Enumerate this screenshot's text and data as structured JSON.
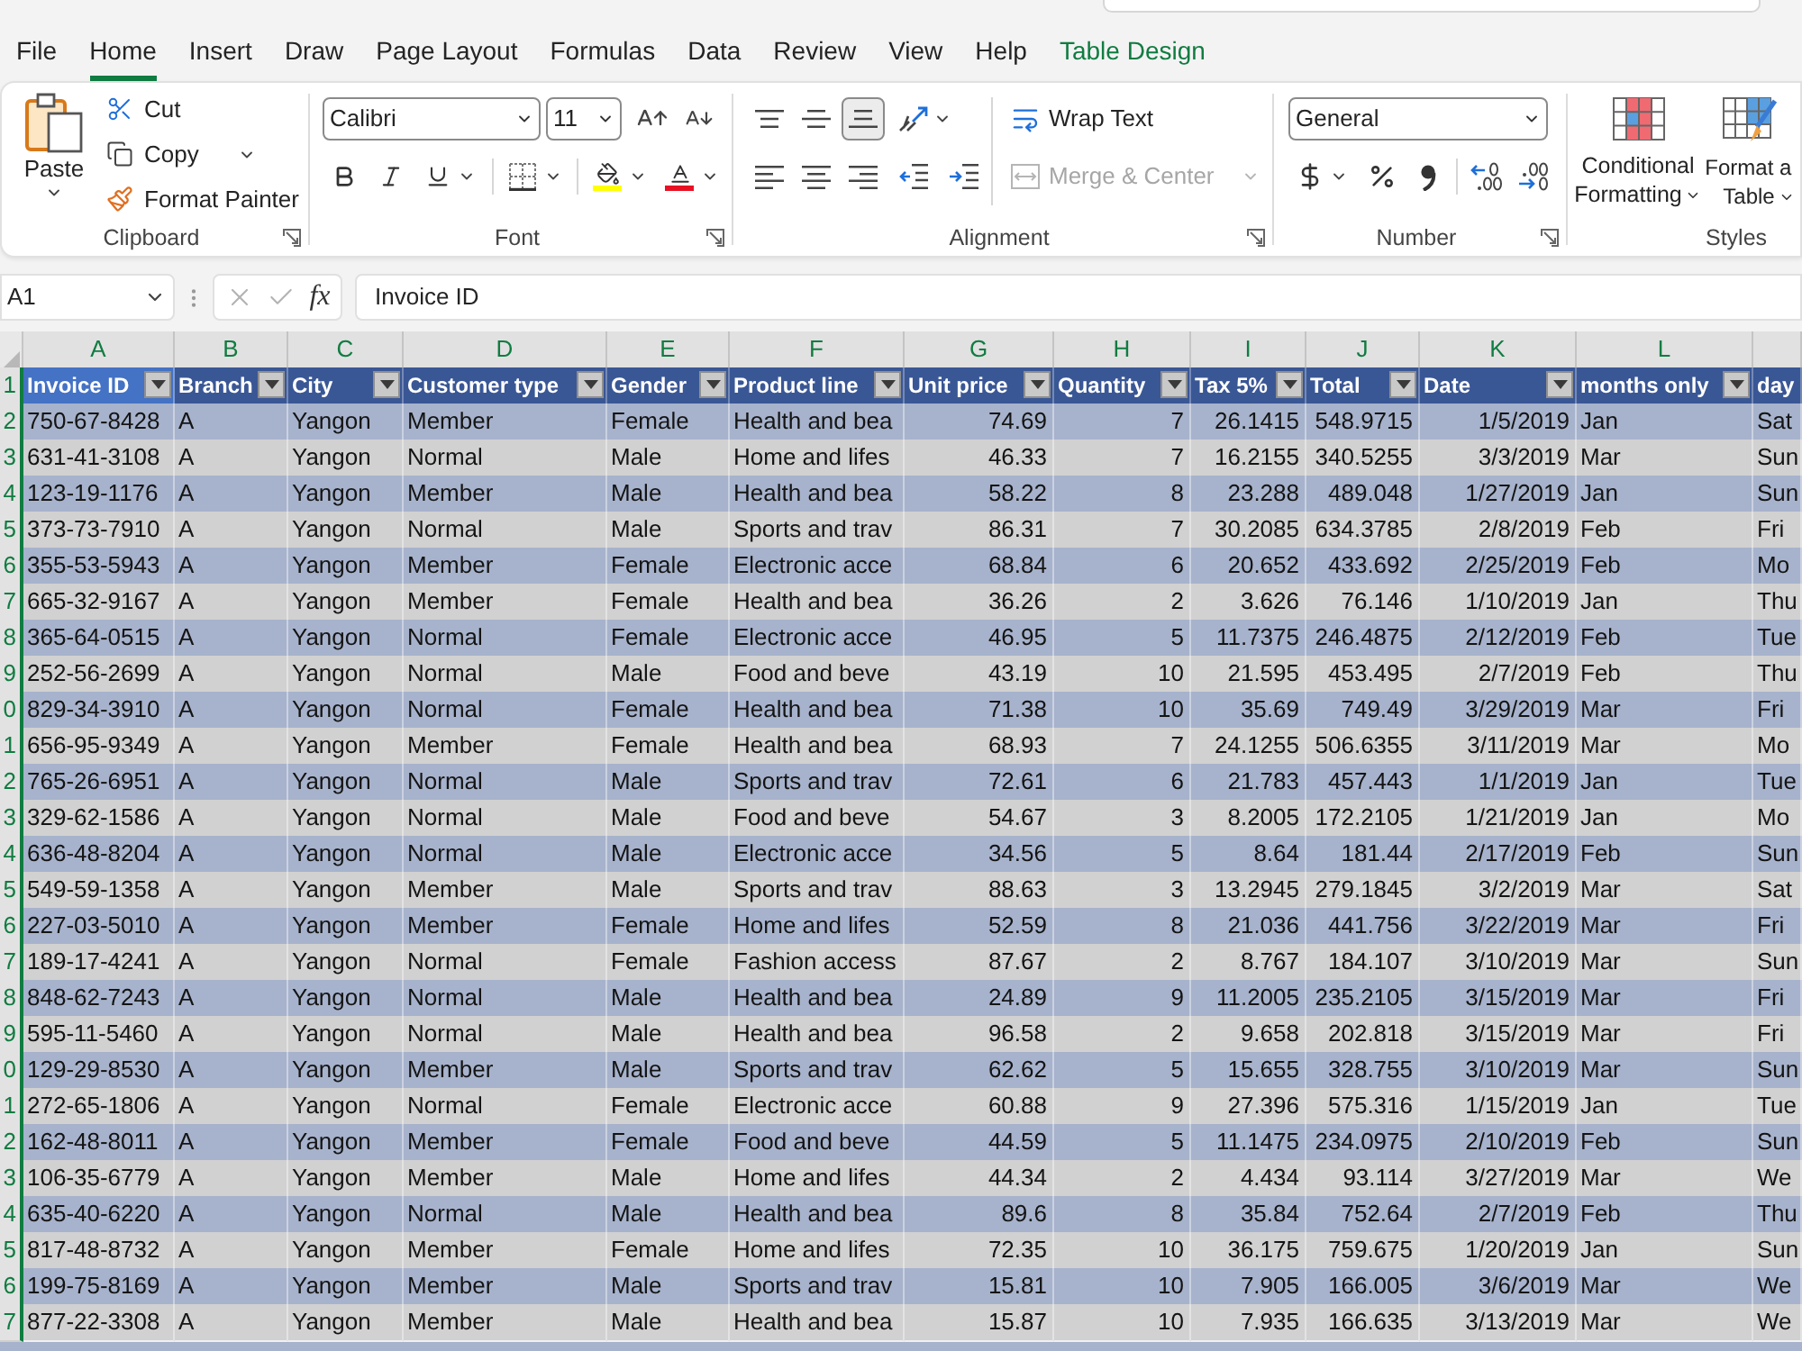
{
  "ribbon_tabs": [
    {
      "label": "File",
      "selected": false,
      "kind": "standard"
    },
    {
      "label": "Home",
      "selected": true,
      "kind": "standard"
    },
    {
      "label": "Insert",
      "selected": false,
      "kind": "standard"
    },
    {
      "label": "Draw",
      "selected": false,
      "kind": "standard"
    },
    {
      "label": "Page Layout",
      "selected": false,
      "kind": "standard"
    },
    {
      "label": "Formulas",
      "selected": false,
      "kind": "standard"
    },
    {
      "label": "Data",
      "selected": false,
      "kind": "standard"
    },
    {
      "label": "Review",
      "selected": false,
      "kind": "standard"
    },
    {
      "label": "View",
      "selected": false,
      "kind": "standard"
    },
    {
      "label": "Help",
      "selected": false,
      "kind": "standard"
    },
    {
      "label": "Table Design",
      "selected": false,
      "kind": "contextual"
    }
  ],
  "ribbon": {
    "groups": [
      {
        "kind": "clipboard",
        "label": "Clipboard",
        "paste": "Paste",
        "cut": "Cut",
        "copy": "Copy",
        "format_painter": "Format Painter"
      },
      {
        "kind": "font",
        "label": "Font",
        "font_name": "Calibri",
        "font_size": "11"
      },
      {
        "kind": "alignment",
        "label": "Alignment",
        "vertical": [
          {
            "kind": "top",
            "selected": false
          },
          {
            "kind": "middle",
            "selected": false
          },
          {
            "kind": "bottom",
            "selected": true
          }
        ],
        "horizontal": [
          {
            "kind": "left",
            "selected": false
          },
          {
            "kind": "center",
            "selected": false
          },
          {
            "kind": "right",
            "selected": false
          }
        ],
        "wrap_text": "Wrap Text",
        "merge": {
          "label": "Merge & Center",
          "disabled": true
        }
      },
      {
        "kind": "number",
        "label": "Number",
        "format": "General"
      },
      {
        "kind": "styles",
        "label": "Styles",
        "buttons": [
          {
            "kind": "conditional_formatting",
            "lines": [
              "Conditional",
              "Formatting"
            ]
          },
          {
            "kind": "format_as_table",
            "lines": [
              "Format a",
              "Table"
            ]
          }
        ]
      }
    ]
  },
  "formula_bar": {
    "name_box": "A1",
    "function_button": "fx",
    "formula": "Invoice ID"
  },
  "sheet": {
    "columns": [
      {
        "letter": "A",
        "selected": true,
        "kind": "text"
      },
      {
        "letter": "B",
        "selected": true,
        "kind": "text"
      },
      {
        "letter": "C",
        "selected": true,
        "kind": "text"
      },
      {
        "letter": "D",
        "selected": true,
        "kind": "text"
      },
      {
        "letter": "E",
        "selected": true,
        "kind": "text"
      },
      {
        "letter": "F",
        "selected": true,
        "kind": "text"
      },
      {
        "letter": "G",
        "selected": true,
        "kind": "number"
      },
      {
        "letter": "H",
        "selected": true,
        "kind": "number"
      },
      {
        "letter": "I",
        "selected": true,
        "kind": "number"
      },
      {
        "letter": "J",
        "selected": true,
        "kind": "number"
      },
      {
        "letter": "K",
        "selected": true,
        "kind": "number"
      },
      {
        "letter": "L",
        "selected": true,
        "kind": "text"
      },
      {
        "selected": true,
        "kind": "text"
      }
    ],
    "header_row": {
      "number": "1",
      "selected": true,
      "cells": [
        {
          "text": "Invoice ID",
          "active": true,
          "filter_button": true
        },
        {
          "text": "Branch",
          "active": false,
          "filter_button": true
        },
        {
          "text": "City",
          "active": false,
          "filter_button": true
        },
        {
          "text": "Customer type",
          "active": false,
          "filter_button": true
        },
        {
          "text": "Gender",
          "active": false,
          "filter_button": true
        },
        {
          "text": "Product line",
          "active": false,
          "filter_button": true
        },
        {
          "text": "Unit price",
          "active": false,
          "filter_button": true
        },
        {
          "text": "Quantity",
          "active": false,
          "filter_button": true
        },
        {
          "text": "Tax 5%",
          "active": false,
          "filter_button": true
        },
        {
          "text": "Total",
          "active": false,
          "filter_button": true
        },
        {
          "text": "Date",
          "active": false,
          "filter_button": true
        },
        {
          "text": "months only",
          "active": false,
          "filter_button": true
        },
        {
          "text": "day",
          "active": false,
          "filter_button": false
        }
      ]
    },
    "rows": [
      {
        "number": "2",
        "selected": true,
        "cells": [
          "750-67-8428",
          "A",
          "Yangon",
          "Member",
          "Female",
          "Health and bea",
          "74.69",
          "7",
          "26.1415",
          "548.9715",
          "1/5/2019",
          "Jan",
          "Sat"
        ]
      },
      {
        "number": "3",
        "selected": true,
        "cells": [
          "631-41-3108",
          "A",
          "Yangon",
          "Normal",
          "Male",
          "Home and lifes",
          "46.33",
          "7",
          "16.2155",
          "340.5255",
          "3/3/2019",
          "Mar",
          "Sun"
        ]
      },
      {
        "number": "4",
        "selected": true,
        "cells": [
          "123-19-1176",
          "A",
          "Yangon",
          "Member",
          "Male",
          "Health and bea",
          "58.22",
          "8",
          "23.288",
          "489.048",
          "1/27/2019",
          "Jan",
          "Sun"
        ]
      },
      {
        "number": "5",
        "selected": true,
        "cells": [
          "373-73-7910",
          "A",
          "Yangon",
          "Normal",
          "Male",
          "Sports and trav",
          "86.31",
          "7",
          "30.2085",
          "634.3785",
          "2/8/2019",
          "Feb",
          "Fri"
        ]
      },
      {
        "number": "6",
        "selected": true,
        "cells": [
          "355-53-5943",
          "A",
          "Yangon",
          "Member",
          "Female",
          "Electronic acce",
          "68.84",
          "6",
          "20.652",
          "433.692",
          "2/25/2019",
          "Feb",
          "Mo"
        ]
      },
      {
        "number": "7",
        "selected": true,
        "cells": [
          "665-32-9167",
          "A",
          "Yangon",
          "Member",
          "Female",
          "Health and bea",
          "36.26",
          "2",
          "3.626",
          "76.146",
          "1/10/2019",
          "Jan",
          "Thu"
        ]
      },
      {
        "number": "8",
        "selected": true,
        "cells": [
          "365-64-0515",
          "A",
          "Yangon",
          "Normal",
          "Female",
          "Electronic acce",
          "46.95",
          "5",
          "11.7375",
          "246.4875",
          "2/12/2019",
          "Feb",
          "Tue"
        ]
      },
      {
        "number": "9",
        "selected": true,
        "cells": [
          "252-56-2699",
          "A",
          "Yangon",
          "Normal",
          "Male",
          "Food and beve",
          "43.19",
          "10",
          "21.595",
          "453.495",
          "2/7/2019",
          "Feb",
          "Thu"
        ]
      },
      {
        "number": "0",
        "selected": true,
        "cells": [
          "829-34-3910",
          "A",
          "Yangon",
          "Normal",
          "Female",
          "Health and bea",
          "71.38",
          "10",
          "35.69",
          "749.49",
          "3/29/2019",
          "Mar",
          "Fri"
        ]
      },
      {
        "number": "1",
        "selected": true,
        "cells": [
          "656-95-9349",
          "A",
          "Yangon",
          "Member",
          "Female",
          "Health and bea",
          "68.93",
          "7",
          "24.1255",
          "506.6355",
          "3/11/2019",
          "Mar",
          "Mo"
        ]
      },
      {
        "number": "2",
        "selected": true,
        "cells": [
          "765-26-6951",
          "A",
          "Yangon",
          "Normal",
          "Male",
          "Sports and trav",
          "72.61",
          "6",
          "21.783",
          "457.443",
          "1/1/2019",
          "Jan",
          "Tue"
        ]
      },
      {
        "number": "3",
        "selected": true,
        "cells": [
          "329-62-1586",
          "A",
          "Yangon",
          "Normal",
          "Male",
          "Food and beve",
          "54.67",
          "3",
          "8.2005",
          "172.2105",
          "1/21/2019",
          "Jan",
          "Mo"
        ]
      },
      {
        "number": "4",
        "selected": true,
        "cells": [
          "636-48-8204",
          "A",
          "Yangon",
          "Normal",
          "Male",
          "Electronic acce",
          "34.56",
          "5",
          "8.64",
          "181.44",
          "2/17/2019",
          "Feb",
          "Sun"
        ]
      },
      {
        "number": "5",
        "selected": true,
        "cells": [
          "549-59-1358",
          "A",
          "Yangon",
          "Member",
          "Male",
          "Sports and trav",
          "88.63",
          "3",
          "13.2945",
          "279.1845",
          "3/2/2019",
          "Mar",
          "Sat"
        ]
      },
      {
        "number": "6",
        "selected": true,
        "cells": [
          "227-03-5010",
          "A",
          "Yangon",
          "Member",
          "Female",
          "Home and lifes",
          "52.59",
          "8",
          "21.036",
          "441.756",
          "3/22/2019",
          "Mar",
          "Fri"
        ]
      },
      {
        "number": "7",
        "selected": true,
        "cells": [
          "189-17-4241",
          "A",
          "Yangon",
          "Normal",
          "Female",
          "Fashion access",
          "87.67",
          "2",
          "8.767",
          "184.107",
          "3/10/2019",
          "Mar",
          "Sun"
        ]
      },
      {
        "number": "8",
        "selected": true,
        "cells": [
          "848-62-7243",
          "A",
          "Yangon",
          "Normal",
          "Male",
          "Health and bea",
          "24.89",
          "9",
          "11.2005",
          "235.2105",
          "3/15/2019",
          "Mar",
          "Fri"
        ]
      },
      {
        "number": "9",
        "selected": true,
        "cells": [
          "595-11-5460",
          "A",
          "Yangon",
          "Normal",
          "Male",
          "Health and bea",
          "96.58",
          "2",
          "9.658",
          "202.818",
          "3/15/2019",
          "Mar",
          "Fri"
        ]
      },
      {
        "number": "0",
        "selected": true,
        "cells": [
          "129-29-8530",
          "A",
          "Yangon",
          "Member",
          "Male",
          "Sports and trav",
          "62.62",
          "5",
          "15.655",
          "328.755",
          "3/10/2019",
          "Mar",
          "Sun"
        ]
      },
      {
        "number": "1",
        "selected": true,
        "cells": [
          "272-65-1806",
          "A",
          "Yangon",
          "Normal",
          "Female",
          "Electronic acce",
          "60.88",
          "9",
          "27.396",
          "575.316",
          "1/15/2019",
          "Jan",
          "Tue"
        ]
      },
      {
        "number": "2",
        "selected": true,
        "cells": [
          "162-48-8011",
          "A",
          "Yangon",
          "Member",
          "Female",
          "Food and beve",
          "44.59",
          "5",
          "11.1475",
          "234.0975",
          "2/10/2019",
          "Feb",
          "Sun"
        ]
      },
      {
        "number": "3",
        "selected": true,
        "cells": [
          "106-35-6779",
          "A",
          "Yangon",
          "Member",
          "Male",
          "Home and lifes",
          "44.34",
          "2",
          "4.434",
          "93.114",
          "3/27/2019",
          "Mar",
          "We"
        ]
      },
      {
        "number": "4",
        "selected": true,
        "cells": [
          "635-40-6220",
          "A",
          "Yangon",
          "Normal",
          "Male",
          "Health and bea",
          "89.6",
          "8",
          "35.84",
          "752.64",
          "2/7/2019",
          "Feb",
          "Thu"
        ]
      },
      {
        "number": "5",
        "selected": true,
        "cells": [
          "817-48-8732",
          "A",
          "Yangon",
          "Member",
          "Female",
          "Home and lifes",
          "72.35",
          "10",
          "36.175",
          "759.675",
          "1/20/2019",
          "Jan",
          "Sun"
        ]
      },
      {
        "number": "6",
        "selected": true,
        "cells": [
          "199-75-8169",
          "A",
          "Yangon",
          "Member",
          "Male",
          "Sports and trav",
          "15.81",
          "10",
          "7.905",
          "166.005",
          "3/6/2019",
          "Mar",
          "We"
        ]
      },
      {
        "number": "7",
        "selected": true,
        "cells": [
          "877-22-3308",
          "A",
          "Yangon",
          "Member",
          "Male",
          "Health and bea",
          "15.87",
          "10",
          "7.935",
          "166.635",
          "3/13/2019",
          "Mar",
          "We"
        ]
      }
    ]
  }
}
